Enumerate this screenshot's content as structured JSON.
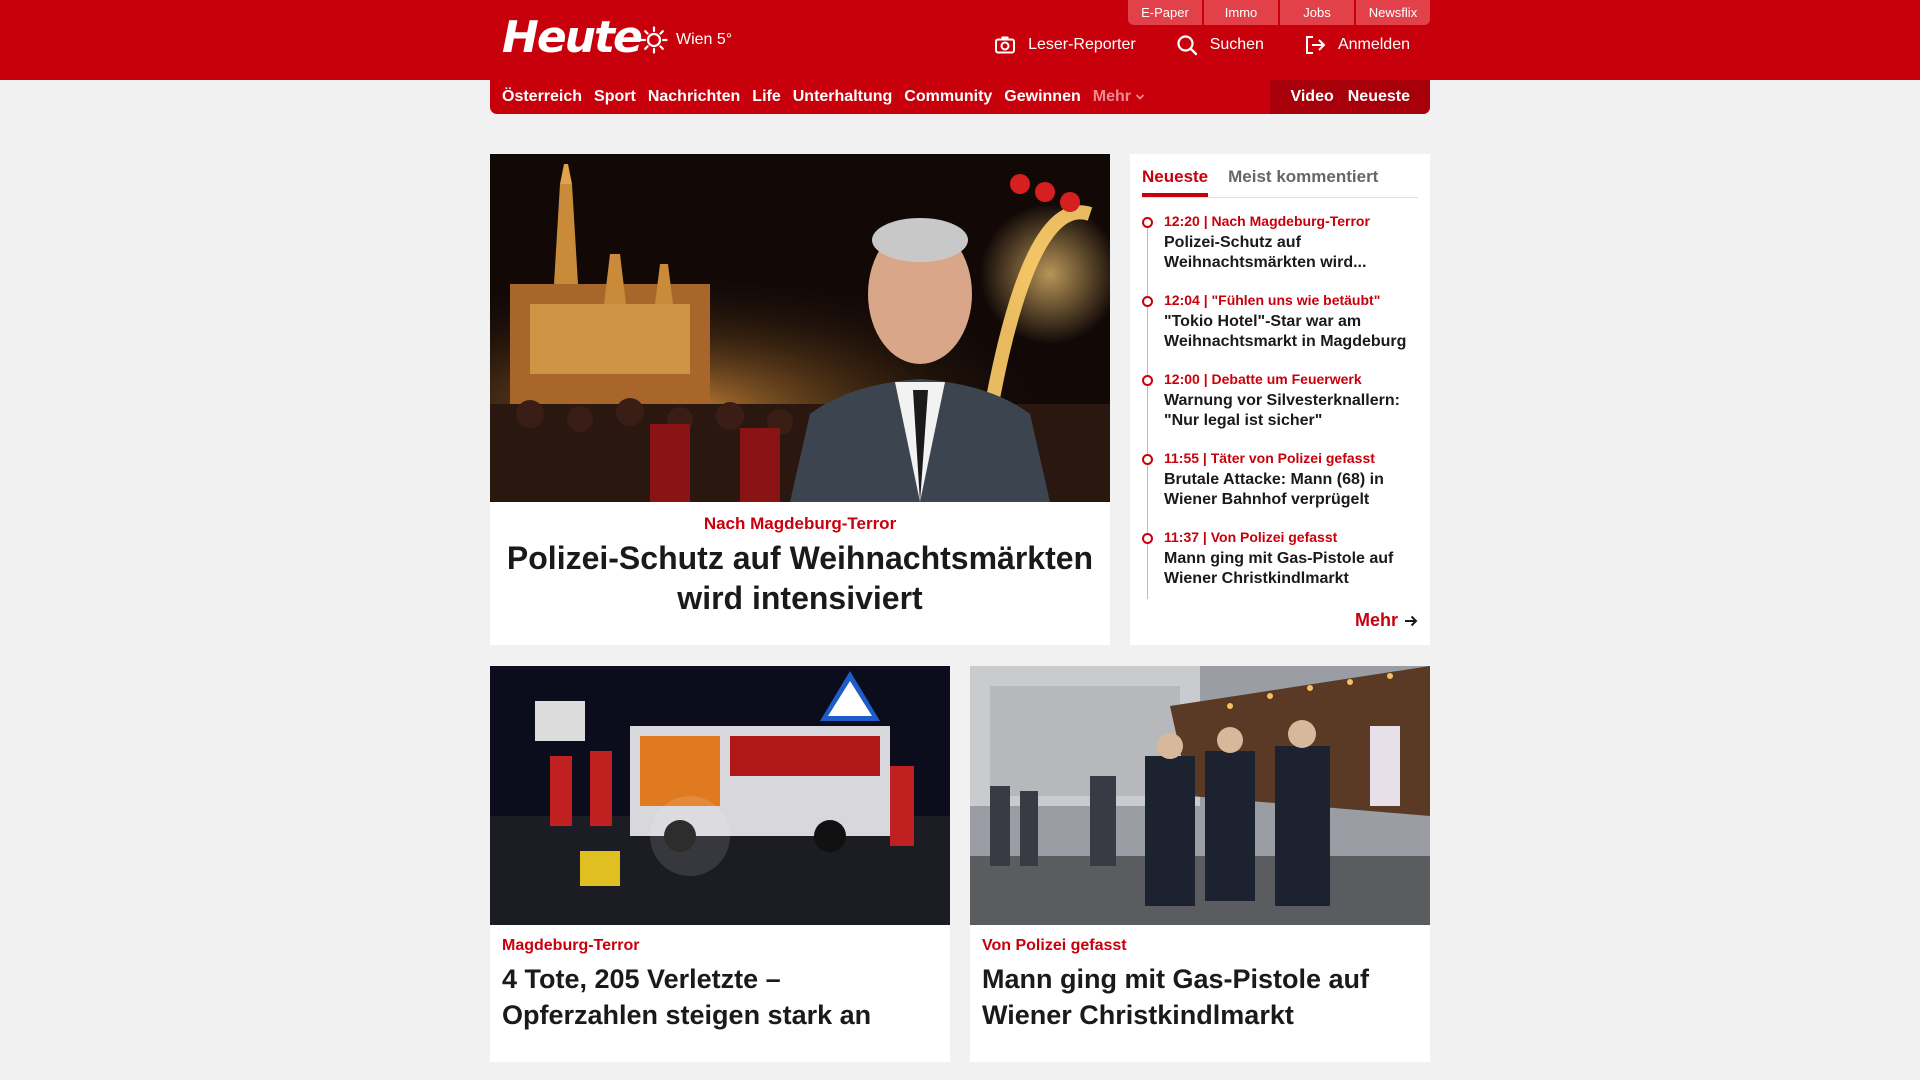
{
  "brand": {
    "logo": "Heute",
    "weather": "Wien 5°",
    "accent": "#c8000c"
  },
  "service_links": [
    "E-Paper",
    "Immo",
    "Jobs",
    "Newsflix"
  ],
  "actions": [
    {
      "label": "Leser-Reporter",
      "icon": "camera-icon"
    },
    {
      "label": "Suchen",
      "icon": "search-icon"
    },
    {
      "label": "Anmelden",
      "icon": "login-icon"
    }
  ],
  "nav": {
    "items": [
      "Österreich",
      "Sport",
      "Nachrichten",
      "Life",
      "Unterhaltung",
      "Community",
      "Gewinnen"
    ],
    "more": "Mehr",
    "right": [
      "Video",
      "Neueste"
    ]
  },
  "lead": {
    "kicker": "Nach Magdeburg-Terror",
    "title": "Polizei-Schutz auf Weihnachtsmärkten wird intensiviert"
  },
  "ticker": {
    "tabs": [
      "Neueste",
      "Meist kommentiert"
    ],
    "items": [
      {
        "meta": "12:20 | Nach Magdeburg-Terror",
        "title": "Polizei-Schutz auf Weihnachtsmärkten wird..."
      },
      {
        "meta": "12:04 | \"Fühlen uns wie betäubt\"",
        "title": "\"Tokio Hotel\"-Star war am Weihnachtsmarkt in Magdeburg"
      },
      {
        "meta": "12:00 | Debatte um Feuerwerk",
        "title": "Warnung vor Silvesterknallern: \"Nur legal ist sicher\""
      },
      {
        "meta": "11:55 | Täter von Polizei gefasst",
        "title": "Brutale Attacke: Mann (68) in Wiener Bahnhof verprügelt"
      },
      {
        "meta": "11:37 | Von Polizei gefasst",
        "title": "Mann ging mit Gas-Pistole auf Wiener Christkindlmarkt"
      }
    ],
    "more": "Mehr"
  },
  "cards": [
    {
      "kicker": "Magdeburg-Terror",
      "title": "4 Tote, 205 Verletzte – Opferzahlen steigen stark an"
    },
    {
      "kicker": "Von Polizei gefasst",
      "title": "Mann ging mit Gas-Pistole auf Wiener Christkindlmarkt"
    }
  ]
}
